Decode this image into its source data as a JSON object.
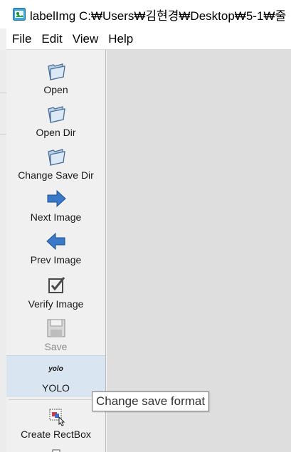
{
  "window": {
    "title": "labelImg C:₩Users₩김현경₩Desktop₩5-1₩줄"
  },
  "menu": [
    "File",
    "Edit",
    "View",
    "Help"
  ],
  "toolbar": {
    "open": "Open",
    "open_dir": "Open Dir",
    "change_save_dir": "Change Save Dir",
    "next_image": "Next Image",
    "prev_image": "Prev Image",
    "verify_image": "Verify Image",
    "save": "Save",
    "yolo_icon_text": "yolo",
    "yolo": "YOLO",
    "create_rectbox": "Create RectBox"
  },
  "tooltip": {
    "text": "Change save format"
  },
  "icons": {
    "app": "labelimg-app-icon",
    "open": "folder-icon",
    "open_dir": "folder-icon",
    "change_save_dir": "folder-icon",
    "next_image": "arrow-right-icon",
    "prev_image": "arrow-left-icon",
    "verify_image": "checkbox-icon",
    "save": "floppy-disk-icon",
    "create_rectbox": "rectbox-icon"
  },
  "colors": {
    "active_tool_bg": "#d9e5f0",
    "arrow_blue": "#3a78c9",
    "canvas_bg": "#dedede"
  }
}
